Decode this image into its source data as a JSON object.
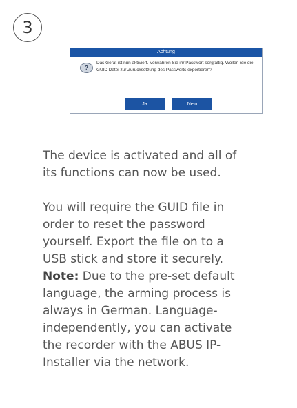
{
  "step_number": "3",
  "dialog": {
    "title": "Achtung",
    "message": "Das Gerät ist nun aktiviert. Verwahren Sie ihr Passwort sorgfältig. Wollen Sie die GUID Datei zur Zurücksetzung des Passworts exportieren?",
    "icon": "question-icon",
    "buttons": {
      "yes_label": "Ja",
      "no_label": "Nein"
    },
    "colors": {
      "titlebar": "#1b55a6",
      "button": "#1c54a3"
    }
  },
  "paragraphs": {
    "p1": "The device is activated and all of its functions can now be used.",
    "p2": "You will require the GUID file in order to reset the password yourself. Export the file on to a USB stick and store it securely.",
    "note_label": "Note:",
    "note_text": " Due to the pre-set default language, the arming process is always in German. Language-independently, you can activate the recorder with the ABUS IP-Installer via the network."
  }
}
